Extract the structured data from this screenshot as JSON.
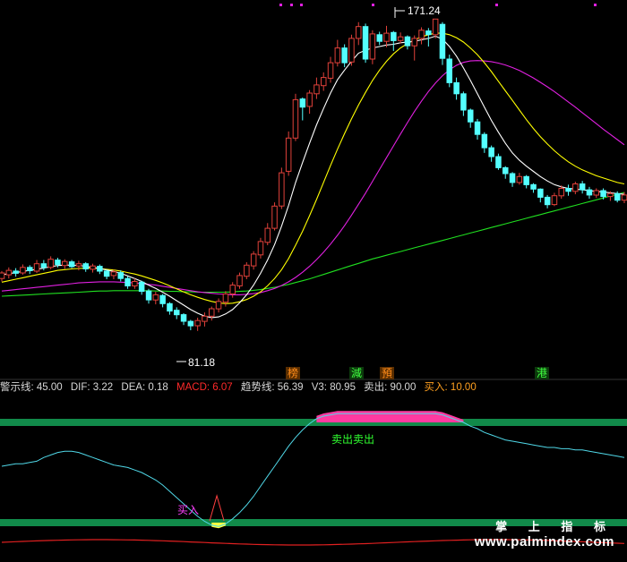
{
  "colors": {
    "bg": "#000000",
    "up": "#e0413a",
    "down": "#54ffff",
    "ma_white": "#ffffff",
    "ma_yellow": "#ffff00",
    "ma_magenta": "#e020e0",
    "ma_green": "#20e020",
    "osc_cyan": "#50d8e8",
    "band_green": "#118a4a",
    "sell_fill": "#ff3aa0",
    "buy_fill": "#ffff40",
    "red_line": "#e02020",
    "label_white": "#d8d8d8",
    "macd_red": "#ff2a2a",
    "buy_orange": "#ffa020",
    "green_text": "#30ff30"
  },
  "price_labels": {
    "high": "171.24",
    "low": "81.18"
  },
  "event_tags": [
    {
      "text": "榜",
      "color": "#ff8c1a",
      "bg": "#5a2e00"
    },
    {
      "text": "減",
      "color": "#40ff40",
      "bg": "#0c3a0c"
    },
    {
      "text": "預",
      "color": "#ff8c1a",
      "bg": "#5a2e00"
    },
    {
      "text": "港",
      "color": "#40ff40",
      "bg": "#0c3a0c"
    }
  ],
  "indicator_bar": {
    "t1": "警示线: 45.00",
    "t2": "DIF: 3.22",
    "t3": "DEA: 0.18",
    "t4": "MACD: 6.07",
    "t5": "趋势线: 56.39",
    "t6": "V3: 80.95",
    "t7": "卖出: 90.00",
    "t8": "买入: 10.00"
  },
  "signals": {
    "sell": "卖出卖出",
    "buy": "买入"
  },
  "watermark": {
    "cn": "掌 上 指 标",
    "url": "www.palmindex.com"
  },
  "chart_data": {
    "type": "candlestick",
    "high_label": 171.24,
    "low_label": 81.18,
    "candles": [
      [
        101,
        102.5,
        100.2,
        103
      ],
      [
        102,
        103.2,
        101,
        104
      ],
      [
        103,
        102.4,
        101.5,
        103.8
      ],
      [
        102.5,
        104,
        102,
        104.8
      ],
      [
        104,
        103.1,
        102.2,
        104.6
      ],
      [
        103,
        105,
        102.5,
        106
      ],
      [
        105,
        104,
        103.2,
        106
      ],
      [
        104,
        106.2,
        103.5,
        107
      ],
      [
        106,
        104.8,
        104,
        106.6
      ],
      [
        104.5,
        105.6,
        103.6,
        106.2
      ],
      [
        105.5,
        104.2,
        103.8,
        106
      ],
      [
        104.4,
        105,
        103.2,
        105.8
      ],
      [
        105,
        103.6,
        102.8,
        105.4
      ],
      [
        103.5,
        104.4,
        102.6,
        105
      ],
      [
        104.3,
        103,
        102.2,
        104.8
      ],
      [
        103,
        101.6,
        100.8,
        103.4
      ],
      [
        101.8,
        102.8,
        100.8,
        103.4
      ],
      [
        102.6,
        101,
        100.2,
        103.2
      ],
      [
        101,
        99,
        98.2,
        101.6
      ],
      [
        99,
        100.2,
        98.2,
        101
      ],
      [
        100,
        97.5,
        96.6,
        100.4
      ],
      [
        97.6,
        95.2,
        94.2,
        98.2
      ],
      [
        95.2,
        96.6,
        94,
        97.4
      ],
      [
        96.4,
        94.2,
        93.2,
        96.8
      ],
      [
        94.2,
        92.2,
        91.2,
        94.6
      ],
      [
        92.4,
        91.2,
        90,
        93.2
      ],
      [
        91.2,
        89.4,
        88.4,
        91.6
      ],
      [
        89.4,
        88.2,
        87,
        89.8
      ],
      [
        88.2,
        89.6,
        86.8,
        90.4
      ],
      [
        89.4,
        90.8,
        88,
        91.8
      ],
      [
        90.8,
        92.8,
        89.6,
        93.4
      ],
      [
        92.8,
        94.8,
        91.8,
        95.6
      ],
      [
        94.6,
        96.8,
        93.4,
        97.6
      ],
      [
        96.8,
        99.2,
        95.8,
        100
      ],
      [
        99,
        101.8,
        98.2,
        102.6
      ],
      [
        101.6,
        104.6,
        100.8,
        105.4
      ],
      [
        104.4,
        107.6,
        103.4,
        108.4
      ],
      [
        107.4,
        111,
        106.4,
        112
      ],
      [
        110.8,
        114.6,
        110,
        116
      ],
      [
        114.6,
        120.6,
        114,
        121.6
      ],
      [
        120.6,
        129.6,
        119.8,
        131
      ],
      [
        130,
        139,
        128.8,
        140.8
      ],
      [
        139,
        149.4,
        138.2,
        151
      ],
      [
        149.6,
        147.4,
        143.8,
        150
      ],
      [
        147.6,
        151.2,
        145.6,
        152
      ],
      [
        151,
        153.4,
        149.6,
        155.4
      ],
      [
        153.2,
        155.4,
        151.8,
        156.8
      ],
      [
        155.2,
        159.4,
        154,
        161
      ],
      [
        159.4,
        163.4,
        158.4,
        165.6
      ],
      [
        163.4,
        159.4,
        158.2,
        164.4
      ],
      [
        159.6,
        166,
        158.6,
        167
      ],
      [
        166,
        169.2,
        164.2,
        170.4
      ],
      [
        169.2,
        160.4,
        159.4,
        170
      ],
      [
        160.4,
        167.2,
        159,
        168.2
      ],
      [
        167,
        165.2,
        164.2,
        167.8
      ],
      [
        165.2,
        167.4,
        163.6,
        169.4
      ],
      [
        167.6,
        165.4,
        162.6,
        168
      ],
      [
        165.4,
        166.4,
        164.6,
        167.6
      ],
      [
        166.4,
        164,
        163,
        166.8
      ],
      [
        164,
        166,
        160,
        166.8
      ],
      [
        166,
        168.2,
        164.4,
        169
      ],
      [
        168,
        167,
        163.8,
        168.8
      ],
      [
        167,
        171.24,
        166,
        171.24
      ],
      [
        169.8,
        160.6,
        158.8,
        170.4
      ],
      [
        160.4,
        154,
        152.8,
        161.6
      ],
      [
        154,
        151,
        149.4,
        155.4
      ],
      [
        151,
        146.6,
        145,
        151.6
      ],
      [
        146.6,
        143.4,
        141.8,
        147
      ],
      [
        143.4,
        140,
        138.6,
        144.2
      ],
      [
        140,
        136.4,
        135,
        140.6
      ],
      [
        136.4,
        134,
        132.6,
        137
      ],
      [
        134,
        131,
        130.4,
        134.8
      ],
      [
        131,
        129.4,
        128,
        131.4
      ],
      [
        129.4,
        127,
        125.8,
        129.8
      ],
      [
        127,
        128.6,
        126.4,
        129.6
      ],
      [
        128.6,
        126.4,
        125.4,
        129
      ],
      [
        126.4,
        125.2,
        124.2,
        126.8
      ],
      [
        125.2,
        123,
        121.6,
        125.4
      ],
      [
        123,
        121,
        120,
        123.6
      ],
      [
        121,
        123.4,
        120.6,
        124.2
      ],
      [
        123.4,
        125.4,
        122.6,
        126.2
      ],
      [
        125.4,
        124.6,
        123.4,
        126.4
      ],
      [
        124.6,
        126.6,
        123.8,
        127.2
      ],
      [
        126.6,
        125,
        124,
        127.4
      ],
      [
        125,
        123.6,
        122.6,
        125.8
      ],
      [
        123.6,
        124.8,
        122.8,
        125.4
      ],
      [
        124.8,
        123.2,
        122.4,
        125.4
      ],
      [
        123.2,
        124,
        122,
        124.6
      ],
      [
        124,
        122.2,
        121.6,
        124.6
      ],
      [
        122.2,
        123.6,
        121.4,
        124.4
      ]
    ],
    "ma_white": [
      102,
      102.3,
      102.6,
      102.9,
      103.2,
      103.5,
      103.8,
      104.2,
      104.5,
      104.6,
      104.6,
      104.5,
      104.3,
      104,
      103.7,
      103.3,
      102.9,
      102.4,
      101.7,
      101,
      100.2,
      99.2,
      98.3,
      97.3,
      96.2,
      95,
      93.8,
      92.6,
      91.6,
      90.8,
      90.4,
      90.6,
      91.4,
      92.6,
      94.4,
      96.6,
      99.2,
      102.4,
      106,
      110.2,
      115.2,
      120.8,
      127,
      132.4,
      137.6,
      142.6,
      147,
      151.2,
      154.8,
      157.4,
      159.8,
      162,
      162.8,
      163.4,
      163.8,
      164.2,
      164.4,
      164.8,
      165,
      165.2,
      165.6,
      166,
      166.6,
      165.8,
      163.8,
      161.2,
      158,
      154.6,
      151,
      147.4,
      143.8,
      140.6,
      137.6,
      135,
      133,
      131.4,
      130,
      128.6,
      127.4,
      126.4,
      125.8,
      125.4,
      125.2,
      125,
      124.8,
      124.6,
      124.4,
      124.2,
      124,
      123.8
    ],
    "ma_yellow": [
      100,
      100.4,
      100.8,
      101.2,
      101.6,
      102,
      102.4,
      102.8,
      103.2,
      103.4,
      103.6,
      103.7,
      103.8,
      103.8,
      103.7,
      103.5,
      103.3,
      103,
      102.6,
      102.2,
      101.7,
      101.1,
      100.5,
      99.8,
      99,
      98.2,
      97.4,
      96.6,
      95.9,
      95.3,
      94.8,
      94.4,
      94.2,
      94.3,
      94.7,
      95.3,
      96.2,
      97.4,
      99,
      101,
      103.4,
      106.4,
      110,
      113.8,
      118,
      122.4,
      127,
      131.6,
      136,
      140.2,
      144.2,
      148,
      151.4,
      154.6,
      157.4,
      159.8,
      161.8,
      163.4,
      164.6,
      165.6,
      166.4,
      167,
      167.4,
      167.4,
      167,
      166.2,
      165,
      163.4,
      161.6,
      159.4,
      157,
      154.4,
      151.8,
      149.2,
      146.6,
      144,
      141.6,
      139.4,
      137.4,
      135.6,
      134,
      132.6,
      131.4,
      130.4,
      129.6,
      128.8,
      128.2,
      127.6,
      127,
      126.6
    ],
    "ma_magenta": [
      97.6,
      97.8,
      98,
      98.2,
      98.4,
      98.6,
      98.8,
      99,
      99.2,
      99.4,
      99.6,
      99.8,
      99.9,
      100,
      100.1,
      100.1,
      100.1,
      100,
      99.9,
      99.8,
      99.6,
      99.4,
      99.2,
      98.9,
      98.6,
      98.3,
      98,
      97.7,
      97.4,
      97.2,
      97,
      96.8,
      96.7,
      96.6,
      96.6,
      96.7,
      96.9,
      97.2,
      97.7,
      98.3,
      99.1,
      100.1,
      101.3,
      102.7,
      104.3,
      106.1,
      108.1,
      110.3,
      112.7,
      115.3,
      118.1,
      121.1,
      124.1,
      127.3,
      130.5,
      133.7,
      136.9,
      140.1,
      143.2,
      146.2,
      149,
      151.6,
      153.9,
      155.9,
      157.5,
      158.7,
      159.5,
      159.9,
      160,
      159.9,
      159.7,
      159.3,
      158.8,
      158.1,
      157.3,
      156.3,
      155.3,
      154.1,
      152.9,
      151.6,
      150.2,
      148.8,
      147.4,
      145.9,
      144.4,
      142.9,
      141.4,
      140,
      138.6,
      137.2
    ],
    "ma_green": [
      96.2,
      96.3,
      96.4,
      96.5,
      96.6,
      96.7,
      96.8,
      96.9,
      97,
      97.1,
      97.2,
      97.3,
      97.4,
      97.5,
      97.6,
      97.6,
      97.7,
      97.7,
      97.7,
      97.7,
      97.7,
      97.7,
      97.6,
      97.6,
      97.5,
      97.5,
      97.4,
      97.4,
      97.3,
      97.3,
      97.3,
      97.3,
      97.3,
      97.4,
      97.5,
      97.6,
      97.8,
      98,
      98.3,
      98.6,
      99,
      99.4,
      99.9,
      100.4,
      100.9,
      101.5,
      102.1,
      102.7,
      103.3,
      103.9,
      104.5,
      105.1,
      105.7,
      106.3,
      106.8,
      107.3,
      107.8,
      108.3,
      108.8,
      109.3,
      109.8,
      110.3,
      110.8,
      111.3,
      111.8,
      112.3,
      112.8,
      113.3,
      113.8,
      114.3,
      114.8,
      115.3,
      115.8,
      116.3,
      116.8,
      117.3,
      117.8,
      118.3,
      118.8,
      119.3,
      119.8,
      120.3,
      120.8,
      121.3,
      121.8,
      122.3,
      122.8,
      123.3,
      123.8,
      124.3
    ],
    "oscillator": [
      55,
      56,
      57,
      57,
      58,
      59,
      62,
      64,
      66,
      67,
      67,
      66,
      64,
      62,
      60,
      58,
      56,
      55,
      54,
      52,
      50,
      47,
      44,
      40,
      35,
      30,
      25,
      20,
      15,
      11,
      8,
      7,
      9,
      13,
      18,
      24,
      31,
      39,
      47,
      55,
      63,
      71,
      78,
      84,
      89,
      93,
      95,
      96,
      97,
      97,
      97,
      97,
      97,
      97,
      97,
      97,
      97,
      97,
      97,
      97,
      97,
      97,
      97,
      96,
      94,
      92,
      90,
      87,
      85,
      82,
      80,
      78,
      76,
      75,
      74,
      73,
      72,
      71,
      70,
      70,
      69,
      69,
      68,
      68,
      67,
      66,
      65,
      64,
      63,
      62
    ],
    "osc_range": [
      0,
      100
    ],
    "sell_threshold": 90,
    "buy_threshold": 10
  }
}
